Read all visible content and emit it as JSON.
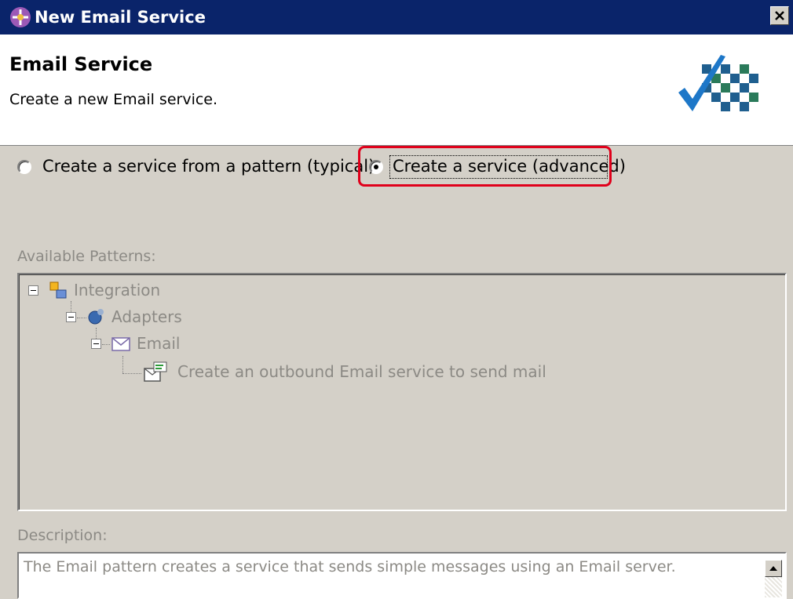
{
  "window": {
    "title": "New Email Service",
    "icon": "wizard-icon"
  },
  "banner": {
    "heading": "Email Service",
    "description": "Create a new Email service."
  },
  "options": {
    "pattern": "Create a service from a pattern (typical)",
    "advanced": "Create a service (advanced)",
    "selected": "advanced"
  },
  "patterns": {
    "label": "Available Patterns:",
    "tree": {
      "integration": "Integration",
      "adapters": "Adapters",
      "email": "Email",
      "outbound": "Create an outbound Email service to send mail"
    }
  },
  "description": {
    "label": "Description:",
    "text": "The Email pattern creates a service that sends simple messages using an Email server."
  },
  "colors": {
    "titlebar": "#0a246a",
    "highlight": "#e0001b",
    "disabled_text": "#8c8a85"
  }
}
